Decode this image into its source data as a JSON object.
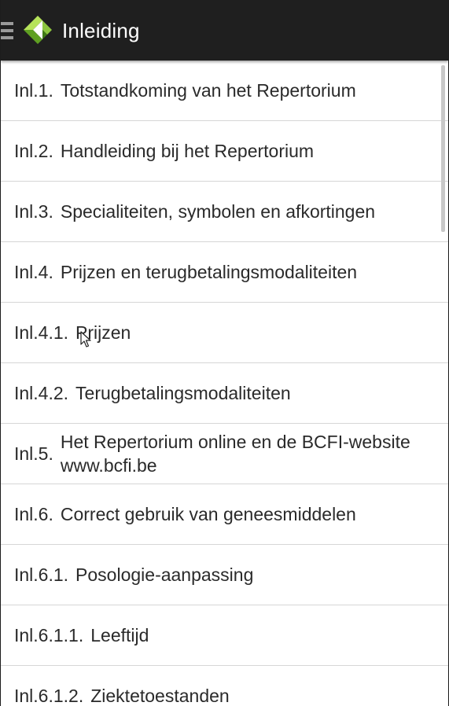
{
  "app": {
    "title": "Inleiding",
    "accent_light": "#8dc63f",
    "accent_dark": "#4f8a1e",
    "appbar_color": "#1f1f1f"
  },
  "icons": {
    "menu": "hamburger-menu-icon",
    "logo": "bcfi-logo-icon",
    "cursor": "mouse-pointer-icon"
  },
  "items": [
    {
      "num": "Inl.1.",
      "label": "Totstandkoming van het Repertorium"
    },
    {
      "num": "Inl.2.",
      "label": "Handleiding bij het Repertorium"
    },
    {
      "num": "Inl.3.",
      "label": "Specialiteiten, symbolen en afkortingen"
    },
    {
      "num": "Inl.4.",
      "label": "Prijzen en terugbetalingsmodaliteiten"
    },
    {
      "num": "Inl.4.1.",
      "label": "Prijzen"
    },
    {
      "num": "Inl.4.2.",
      "label": "Terugbetalingsmodaliteiten"
    },
    {
      "num": "Inl.5.",
      "label": "Het Repertorium online en de BCFI-website www.bcfi.be"
    },
    {
      "num": "Inl.6.",
      "label": "Correct gebruik van geneesmiddelen"
    },
    {
      "num": "Inl.6.1.",
      "label": "Posologie-aanpassing"
    },
    {
      "num": "Inl.6.1.1.",
      "label": "Leeftijd"
    },
    {
      "num": "Inl.6.1.2.",
      "label": "Ziektetoestanden"
    }
  ]
}
